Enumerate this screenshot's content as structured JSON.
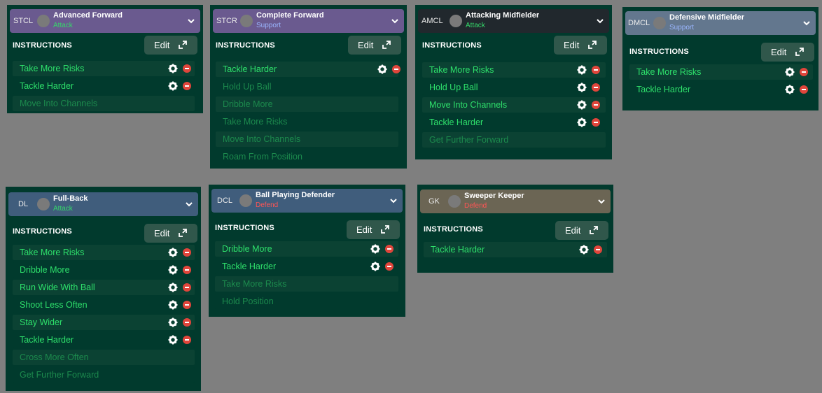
{
  "colors": {
    "page_bg": "#7f7f7f",
    "panel_bg": "#013a2d",
    "header_attack_purple": "#6a5a8f",
    "header_dark": "#21282d",
    "header_blue": "#405d7c",
    "header_slate": "#63778e",
    "header_brown": "#6b6554",
    "duty_attack": "#35d86a",
    "duty_support": "#9ab6ff",
    "duty_defend": "#ff5555",
    "instruction_active": "#2ee06b",
    "instruction_inactive": "#1c8a4d"
  },
  "common": {
    "instructions_label": "INSTRUCTIONS",
    "edit_label": "Edit"
  },
  "panels": [
    {
      "position": "STCL",
      "role": "Advanced Forward",
      "duty": "Attack",
      "instructions": [
        {
          "label": "Take More Risks",
          "active": true
        },
        {
          "label": "Tackle Harder",
          "active": true
        },
        {
          "label": "Move Into Channels",
          "active": false
        }
      ]
    },
    {
      "position": "STCR",
      "role": "Complete Forward",
      "duty": "Support",
      "instructions": [
        {
          "label": "Tackle Harder",
          "active": true
        },
        {
          "label": "Hold Up Ball",
          "active": false
        },
        {
          "label": "Dribble More",
          "active": false
        },
        {
          "label": "Take More Risks",
          "active": false
        },
        {
          "label": "Move Into Channels",
          "active": false
        },
        {
          "label": "Roam From Position",
          "active": false
        }
      ]
    },
    {
      "position": "AMCL",
      "role": "Attacking Midfielder",
      "duty": "Attack",
      "instructions": [
        {
          "label": "Take More Risks",
          "active": true
        },
        {
          "label": "Hold Up Ball",
          "active": true
        },
        {
          "label": "Move Into Channels",
          "active": true
        },
        {
          "label": "Tackle Harder",
          "active": true
        },
        {
          "label": "Get Further Forward",
          "active": false
        }
      ]
    },
    {
      "position": "DMCL",
      "role": "Defensive Midfielder",
      "duty": "Support",
      "instructions": [
        {
          "label": "Take More Risks",
          "active": true
        },
        {
          "label": "Tackle Harder",
          "active": true
        }
      ]
    },
    {
      "position": "DL",
      "role": "Full-Back",
      "duty": "Attack",
      "instructions": [
        {
          "label": "Take More Risks",
          "active": true
        },
        {
          "label": "Dribble More",
          "active": true
        },
        {
          "label": "Run Wide With Ball",
          "active": true
        },
        {
          "label": "Shoot Less Often",
          "active": true
        },
        {
          "label": "Stay Wider",
          "active": true
        },
        {
          "label": "Tackle Harder",
          "active": true
        },
        {
          "label": "Cross More Often",
          "active": false
        },
        {
          "label": "Get Further Forward",
          "active": false
        }
      ]
    },
    {
      "position": "DCL",
      "role": "Ball Playing Defender",
      "duty": "Defend",
      "instructions": [
        {
          "label": "Dribble More",
          "active": true
        },
        {
          "label": "Tackle Harder",
          "active": true
        },
        {
          "label": "Take More Risks",
          "active": false
        },
        {
          "label": "Hold Position",
          "active": false
        }
      ]
    },
    {
      "position": "GK",
      "role": "Sweeper Keeper",
      "duty": "Defend",
      "instructions": [
        {
          "label": "Tackle Harder",
          "active": true
        }
      ]
    }
  ]
}
